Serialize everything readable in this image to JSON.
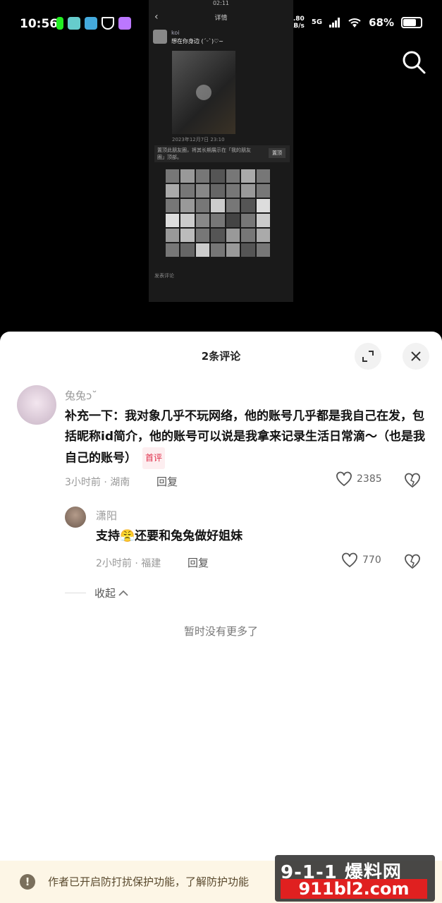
{
  "status_bar": {
    "time": "10:56",
    "speed_top": "0.80",
    "speed_unit": "KB/s",
    "network": "5G",
    "battery": "68%",
    "battery_level": 0.68
  },
  "embedded": {
    "time": "02:11",
    "title": "详情",
    "user": "koi",
    "post_text": "想在你身边 (ˊᵕˋ)♡~",
    "date": "2023年12月7日 23:10",
    "pin_notice": "置顶此朋友圈，将其长期展示在「我的朋友圈」顶部。",
    "pin_button": "置顶",
    "comment_placeholder": "发表评论"
  },
  "sheet": {
    "title": "2条评论",
    "no_more": "暂时没有更多了",
    "collapse_label": "收起"
  },
  "comments": [
    {
      "name": "兔兔ↄ˘",
      "text": "补充一下：我对象几乎不玩网络，他的账号几乎都是我自己在发，包括昵称id简介，他的账号可以说是我拿来记录生活日常滴～（也是我自己的账号）",
      "tag": "首评",
      "time_location": "3小时前 · 湖南",
      "reply_label": "回复",
      "likes": "2385"
    },
    {
      "name": "潇阳",
      "text_before": "支持",
      "emoji": "😤",
      "text_after": "还要和兔兔做好姐妹",
      "time_location": "2小时前 · 福建",
      "reply_label": "回复",
      "likes": "770"
    }
  ],
  "notice": {
    "text": "作者已开启防打扰保护功能，了解防护功能"
  },
  "watermark": {
    "top": "9-1-1 爆料网",
    "bottom": "911bl2.com"
  }
}
